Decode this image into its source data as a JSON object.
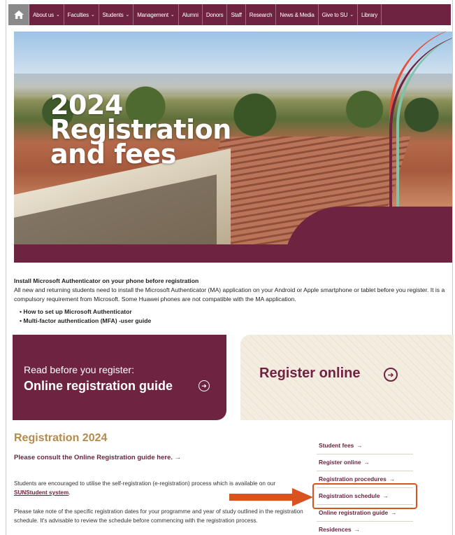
{
  "nav": {
    "items": [
      {
        "label": "About us",
        "has_dropdown": true
      },
      {
        "label": "Faculties",
        "has_dropdown": true
      },
      {
        "label": "Students",
        "has_dropdown": true
      },
      {
        "label": "Management",
        "has_dropdown": true
      },
      {
        "label": "Alumni",
        "has_dropdown": false
      },
      {
        "label": "Donors",
        "has_dropdown": false
      },
      {
        "label": "Staff",
        "has_dropdown": false
      },
      {
        "label": "Research",
        "has_dropdown": false
      },
      {
        "label": "News & Media",
        "has_dropdown": false
      },
      {
        "label": "Give to SU",
        "has_dropdown": true
      },
      {
        "label": "Library",
        "has_dropdown": false
      }
    ],
    "home_icon": "home-icon"
  },
  "hero": {
    "title_line1": "2024",
    "title_line2": "Registration",
    "title_line3": "and fees"
  },
  "notice": {
    "heading": "Install Microsoft Authenticator on your phone before registration",
    "body": "All new and returning students need to install the Microsoft Authenticator (MA) application on your Android or Apple smartphone or tablet before you register. It is a compulsory requirement from Microsoft. Some Huawei phones are not compatible with the MA application.",
    "links": [
      "How to set up Microsoft Authenticator",
      "Multi-factor authentication (MFA) -user guide"
    ]
  },
  "cards": {
    "left_line1": "Read before you register:",
    "left_line2": "Online registration guide",
    "right_label": "Register online"
  },
  "registration": {
    "title": "Registration 2024",
    "subtitle": "Please consult the Online Registration guide here. →",
    "para1_a": "Students are encouraged to utilise the self-registration (e-registration) process which is available on our ",
    "para1_link": "SUNStudent system",
    "para1_b": ".",
    "para2": "Please take note of the specific registration dates for your programme and year of study outlined in the registration schedule. It's advisable to review the schedule before commencing with the registration process."
  },
  "sidebar_links": [
    "Student fees",
    "Register online",
    "Registration procedures",
    "Registration schedule",
    "Online registration guide",
    "Residences"
  ],
  "colors": {
    "brand": "#6e2340",
    "accent_gold": "#b58a4b",
    "highlight": "#d9531e"
  }
}
